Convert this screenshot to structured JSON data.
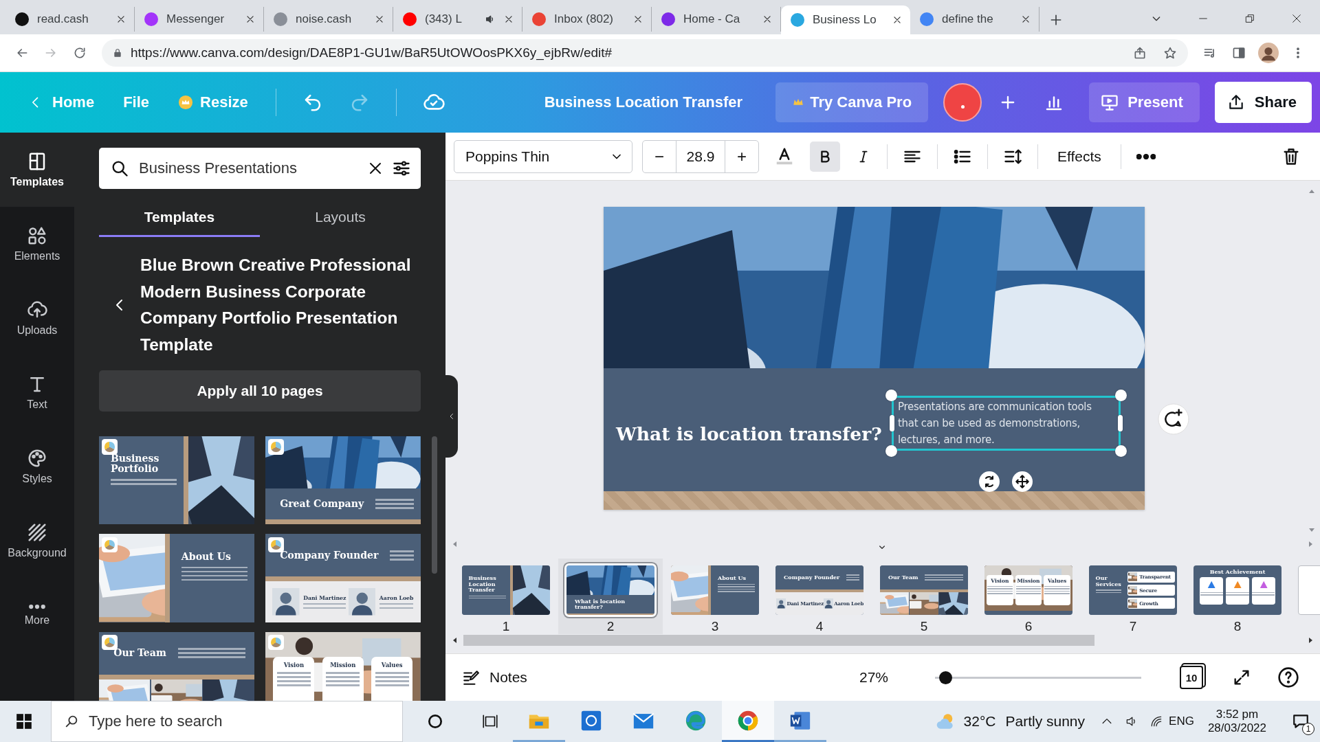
{
  "browser": {
    "tabs": [
      {
        "title": "read.cash",
        "color": "#111111",
        "audio": false,
        "selected": false
      },
      {
        "title": "Messenger",
        "color": "#a334fa",
        "audio": false,
        "selected": false
      },
      {
        "title": "noise.cash",
        "color": "#8a8f98",
        "audio": false,
        "selected": false
      },
      {
        "title": "(343) L",
        "color": "#ff0000",
        "audio": true,
        "selected": false
      },
      {
        "title": "Inbox (802)",
        "color": "#ea4335",
        "audio": false,
        "selected": false
      },
      {
        "title": "Home - Ca",
        "color": "#7d2ae8",
        "audio": false,
        "selected": false
      },
      {
        "title": "Business Lo",
        "color": "#2aa8e0",
        "audio": false,
        "selected": true
      },
      {
        "title": "define the",
        "color": "#4285f4",
        "audio": false,
        "selected": false
      }
    ],
    "url": "https://www.canva.com/design/DAE8P1-GU1w/BaR5UtOWOosPKX6y_ejbRw/edit#"
  },
  "header": {
    "home": "Home",
    "file": "File",
    "resize": "Resize",
    "title": "Business Location Transfer",
    "pro": "Try Canva Pro",
    "present": "Present",
    "share": "Share"
  },
  "rail": [
    {
      "label": "Templates",
      "kind": "templates",
      "selected": true
    },
    {
      "label": "Elements",
      "kind": "elements",
      "selected": false
    },
    {
      "label": "Uploads",
      "kind": "uploads",
      "selected": false
    },
    {
      "label": "Text",
      "kind": "text",
      "selected": false
    },
    {
      "label": "Styles",
      "kind": "styles",
      "selected": false
    },
    {
      "label": "Background",
      "kind": "background",
      "selected": false
    },
    {
      "label": "More",
      "kind": "more",
      "selected": false
    }
  ],
  "panel": {
    "search": {
      "value": "Business Presentations"
    },
    "tabs": [
      {
        "label": "Templates",
        "selected": true
      },
      {
        "label": "Layouts",
        "selected": false
      }
    ],
    "template_title": "Blue Brown Creative Professional Modern Business Corporate Company Portfolio Presentation Template",
    "apply_button": "Apply all 10 pages",
    "thumbnails": [
      {
        "kind": "portfolio",
        "title": "Business Portfolio"
      },
      {
        "kind": "cover",
        "title": "Great Company"
      },
      {
        "kind": "about",
        "title": "About Us"
      },
      {
        "kind": "founder",
        "title": "Company Founder",
        "people": [
          "Dani Martinez",
          "Aaron Loeb"
        ]
      },
      {
        "kind": "team",
        "title": "Our Team"
      },
      {
        "kind": "cards",
        "cards": [
          "Vision",
          "Mission",
          "Values"
        ]
      }
    ]
  },
  "toolbar": {
    "font": "Poppins Thin",
    "minus": "−",
    "size": "28.9",
    "plus": "+",
    "bold": true,
    "italic": false,
    "effects": "Effects"
  },
  "slide": {
    "title": "What is location transfer?",
    "body": "Presentations are communication tools that can be used as demonstrations, lectures, and more."
  },
  "pages": [
    {
      "number": "1",
      "kind": "portfolio",
      "title": "Business Location Transfer",
      "selected": false
    },
    {
      "number": "2",
      "kind": "cover",
      "title": "What is location transfer?",
      "selected": true
    },
    {
      "number": "3",
      "kind": "about",
      "title": "About Us",
      "selected": false
    },
    {
      "number": "4",
      "kind": "founder",
      "title": "Company Founder",
      "people": [
        "Dani Martinez",
        "Aaron Loeb"
      ],
      "selected": false
    },
    {
      "number": "5",
      "kind": "team",
      "title": "Our Team",
      "selected": false
    },
    {
      "number": "6",
      "kind": "cards",
      "cards": [
        "Vision",
        "Mission",
        "Values"
      ],
      "selected": false
    },
    {
      "number": "7",
      "kind": "services",
      "title": "Our Services",
      "rows": [
        "Transparent",
        "Secure",
        "Growth"
      ],
      "selected": false
    },
    {
      "number": "8",
      "kind": "achievement",
      "title": "Best Achievement",
      "selected": false
    }
  ],
  "footer": {
    "notes": "Notes",
    "zoom": "27%",
    "zoom_slider": {
      "level": 0.02
    },
    "page_count": "10"
  },
  "taskbar": {
    "search_placeholder": "Type here to search",
    "apps": [
      {
        "kind": "explorer",
        "running": true,
        "active": false
      },
      {
        "kind": "photos",
        "running": false,
        "active": false
      },
      {
        "kind": "mail",
        "running": false,
        "active": false
      },
      {
        "kind": "edge",
        "running": false,
        "active": false
      },
      {
        "kind": "chrome",
        "running": true,
        "active": true
      },
      {
        "kind": "word",
        "running": true,
        "active": false
      }
    ],
    "temperature": "32°C",
    "weather": "Partly sunny",
    "language": "ENG",
    "time": "3:52 pm",
    "date": "28/03/2022",
    "notifications": "1"
  }
}
